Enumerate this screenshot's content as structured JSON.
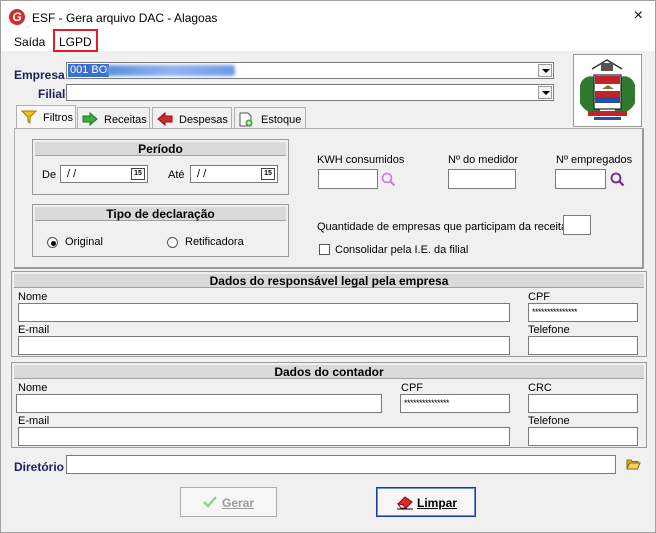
{
  "window": {
    "title": "ESF - Gera arquivo DAC - Alagoas",
    "close_glyph": "×",
    "icon_letter": "G"
  },
  "menu": {
    "items": [
      "Saída",
      "LGPD"
    ]
  },
  "empresa": {
    "label": "Empresa",
    "value": "001 BO"
  },
  "filial": {
    "label": "Filial",
    "value": ""
  },
  "tabs": [
    "Filtros",
    "Receitas",
    "Despesas",
    "Estoque"
  ],
  "periodo": {
    "title": "Período",
    "de_label": "De",
    "ate_label": "Até",
    "de_value": "/ /",
    "ate_value": "/ /",
    "cal_glyph": "15"
  },
  "tipo": {
    "title": "Tipo de declaração",
    "original": "Original",
    "retificadora": "Retificadora"
  },
  "filtros": {
    "kwh_label": "KWH consumidos",
    "medidor_label": "Nº do medidor",
    "empregados_label": "Nº empregados",
    "qtd_empresas_label": "Quantidade de empresas que participam da receita",
    "consolidar_label": "Consolidar pela I.E. da filial"
  },
  "responsavel": {
    "title": "Dados do responsável legal pela empresa",
    "nome_label": "Nome",
    "cpf_label": "CPF",
    "email_label": "E-mail",
    "telefone_label": "Telefone",
    "cpf_value": "***************"
  },
  "contador": {
    "title": "Dados do contador",
    "nome_label": "Nome",
    "cpf_label": "CPF",
    "crc_label": "CRC",
    "email_label": "E-mail",
    "telefone_label": "Telefone",
    "cpf_value": "***************"
  },
  "diretorio": {
    "label": "Diretório",
    "value": ""
  },
  "buttons": {
    "gerar": "Gerar",
    "limpar": "Limpar"
  },
  "colors": {
    "accent": "#1a3a9c",
    "lgpd_highlight": "#e02020",
    "selection": "#3b6fd0"
  }
}
